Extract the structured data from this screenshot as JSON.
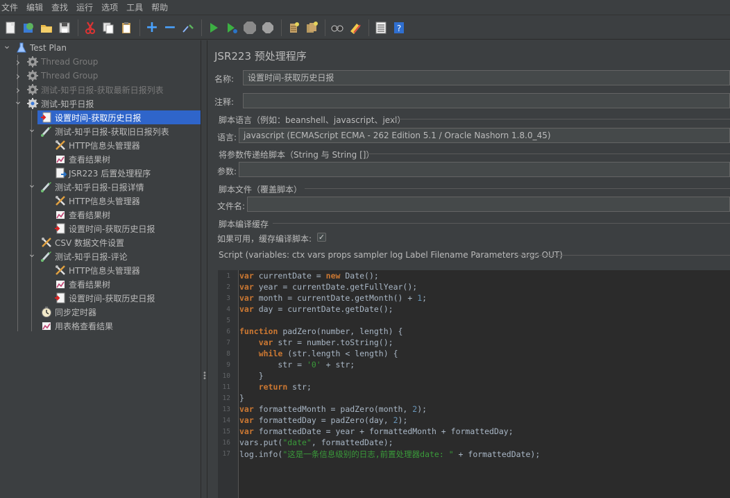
{
  "menu": [
    "文件",
    "编辑",
    "查找",
    "运行",
    "选项",
    "工具",
    "帮助"
  ],
  "toolbar_icons": [
    "new-icon",
    "templates-icon",
    "open-icon",
    "save-icon",
    "cut-icon",
    "copy-icon",
    "paste-icon",
    "expand-icon",
    "collapse-icon",
    "toggle-icon",
    "start-icon",
    "start-no-pause-icon",
    "stop-icon",
    "shutdown-icon",
    "clear-icon",
    "clear-all-icon",
    "search-icon",
    "reset-search-icon",
    "function-helper-icon",
    "help-icon"
  ],
  "tree": [
    {
      "label": "Test Plan",
      "icon": "test-plan-icon",
      "indent": 0,
      "twisty": "v",
      "disabled": false,
      "selected": false
    },
    {
      "label": "Thread Group",
      "icon": "thread-group-icon",
      "indent": 1,
      "twisty": ">",
      "disabled": true,
      "selected": false
    },
    {
      "label": "Thread Group",
      "icon": "thread-group-icon",
      "indent": 1,
      "twisty": ">",
      "disabled": true,
      "selected": false
    },
    {
      "label": "测试-知乎日报-获取最新日报列表",
      "icon": "thread-group-icon",
      "indent": 1,
      "twisty": ">",
      "disabled": true,
      "selected": false
    },
    {
      "label": "测试-知乎日报",
      "icon": "thread-group-icon",
      "indent": 1,
      "twisty": "v",
      "disabled": false,
      "selected": false
    },
    {
      "label": "设置时间-获取历史日报",
      "icon": "preprocessor-icon",
      "indent": 2,
      "twisty": "",
      "disabled": false,
      "selected": true
    },
    {
      "label": "测试-知乎日报-获取旧日报列表",
      "icon": "sampler-icon",
      "indent": 2,
      "twisty": "v",
      "disabled": false,
      "selected": false
    },
    {
      "label": "HTTP信息头管理器",
      "icon": "config-icon",
      "indent": 3,
      "twisty": "",
      "disabled": false,
      "selected": false
    },
    {
      "label": "查看结果树",
      "icon": "listener-icon",
      "indent": 3,
      "twisty": "",
      "disabled": false,
      "selected": false
    },
    {
      "label": "JSR223 后置处理程序",
      "icon": "postprocessor-icon",
      "indent": 3,
      "twisty": "",
      "disabled": false,
      "selected": false
    },
    {
      "label": "测试-知乎日报-日报详情",
      "icon": "sampler-icon",
      "indent": 2,
      "twisty": "v",
      "disabled": false,
      "selected": false
    },
    {
      "label": "HTTP信息头管理器",
      "icon": "config-icon",
      "indent": 3,
      "twisty": "",
      "disabled": false,
      "selected": false
    },
    {
      "label": "查看结果树",
      "icon": "listener-icon",
      "indent": 3,
      "twisty": "",
      "disabled": false,
      "selected": false
    },
    {
      "label": "设置时间-获取历史日报",
      "icon": "preprocessor-icon",
      "indent": 3,
      "twisty": "",
      "disabled": false,
      "selected": false
    },
    {
      "label": "CSV 数据文件设置",
      "icon": "config-icon",
      "indent": 2,
      "twisty": "",
      "disabled": false,
      "selected": false
    },
    {
      "label": "测试-知乎日报-评论",
      "icon": "sampler-icon",
      "indent": 2,
      "twisty": "v",
      "disabled": false,
      "selected": false
    },
    {
      "label": "HTTP信息头管理器",
      "icon": "config-icon",
      "indent": 3,
      "twisty": "",
      "disabled": false,
      "selected": false
    },
    {
      "label": "查看结果树",
      "icon": "listener-icon",
      "indent": 3,
      "twisty": "",
      "disabled": false,
      "selected": false
    },
    {
      "label": "设置时间-获取历史日报",
      "icon": "preprocessor-icon",
      "indent": 3,
      "twisty": "",
      "disabled": false,
      "selected": false
    },
    {
      "label": "同步定时器",
      "icon": "timer-icon",
      "indent": 2,
      "twisty": "",
      "disabled": false,
      "selected": false
    },
    {
      "label": "用表格查看结果",
      "icon": "listener-icon",
      "indent": 2,
      "twisty": "",
      "disabled": false,
      "selected": false
    }
  ],
  "panel": {
    "title": "JSR223 预处理程序",
    "name_label": "名称:",
    "name_value": "设置时间-获取历史日报",
    "comment_label": "注释:",
    "comment_value": "",
    "lang_section": "脚本语言（例如：beanshell、javascript、jexl）",
    "lang_label": "语言:",
    "lang_value": "javascript     (ECMAScript ECMA - 262 Edition 5.1 / Oracle Nashorn 1.8.0_45)",
    "params_section": "将参数传递给脚本（String 与 String []）",
    "params_label": "参数:",
    "params_value": "",
    "file_section": "脚本文件（覆盖脚本）",
    "file_label": "文件名:",
    "file_value": "",
    "cache_section": "脚本编译缓存",
    "cache_label": "如果可用，缓存编译脚本:",
    "cache_checked": true,
    "cache_check_glyph": "✓",
    "script_section": "Script (variables: ctx vars props sampler log Label Filename Parameters args OUT)"
  },
  "code": [
    [
      [
        "kw",
        "var"
      ],
      [
        "p",
        " currentDate = "
      ],
      [
        "kw",
        "new"
      ],
      [
        "p",
        " Date();"
      ]
    ],
    [
      [
        "kw",
        "var"
      ],
      [
        "p",
        " year = currentDate.getFullYear();"
      ]
    ],
    [
      [
        "kw",
        "var"
      ],
      [
        "p",
        " month = currentDate.getMonth() + "
      ],
      [
        "num",
        "1"
      ],
      [
        "p",
        ";"
      ]
    ],
    [
      [
        "kw",
        "var"
      ],
      [
        "p",
        " day = currentDate.getDate();"
      ]
    ],
    [],
    [
      [
        "kw",
        "function"
      ],
      [
        "p",
        " padZero(number, length) {"
      ]
    ],
    [
      [
        "p",
        "    "
      ],
      [
        "kw",
        "var"
      ],
      [
        "p",
        " str = number.toString();"
      ]
    ],
    [
      [
        "p",
        "    "
      ],
      [
        "kw",
        "while"
      ],
      [
        "p",
        " (str.length < length) {"
      ]
    ],
    [
      [
        "p",
        "        str = "
      ],
      [
        "str",
        "'0'"
      ],
      [
        "p",
        " + str;"
      ]
    ],
    [
      [
        "p",
        "    }"
      ]
    ],
    [
      [
        "p",
        "    "
      ],
      [
        "kw",
        "return"
      ],
      [
        "p",
        " str;"
      ]
    ],
    [
      [
        "p",
        "}"
      ]
    ],
    [
      [
        "kw",
        "var"
      ],
      [
        "p",
        " formattedMonth = padZero(month, "
      ],
      [
        "num",
        "2"
      ],
      [
        "p",
        ");"
      ]
    ],
    [
      [
        "kw",
        "var"
      ],
      [
        "p",
        " formattedDay = padZero(day, "
      ],
      [
        "num",
        "2"
      ],
      [
        "p",
        ");"
      ]
    ],
    [
      [
        "kw",
        "var"
      ],
      [
        "p",
        " formattedDate = year + formattedMonth + formattedDay;"
      ]
    ],
    [
      [
        "p",
        "vars.put("
      ],
      [
        "str",
        "\"date\""
      ],
      [
        "p",
        ", formattedDate);"
      ]
    ],
    [
      [
        "p",
        "log.info("
      ],
      [
        "str",
        "\"这是一条信息级别的日志,前置处理器date: \""
      ],
      [
        "p",
        " + formattedDate);"
      ]
    ]
  ],
  "colors": {
    "selection": "#2f65ca",
    "background": "#3c3f41",
    "editor_bg": "#2b2b2b",
    "keyword": "#cc7832",
    "string": "#3a9a3a",
    "number": "#6897bb"
  }
}
